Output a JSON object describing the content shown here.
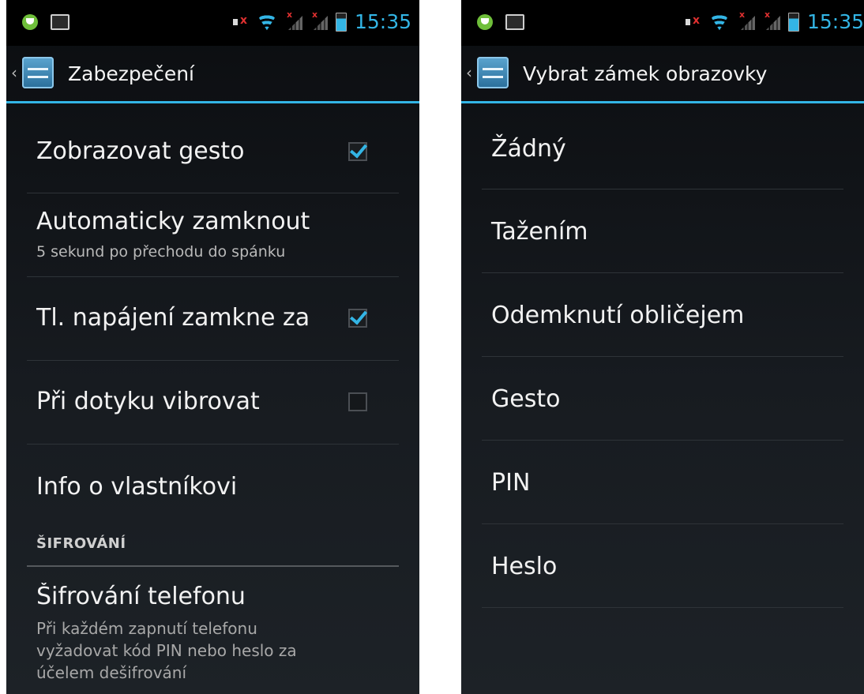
{
  "left": {
    "status": {
      "time": "15:35"
    },
    "title": "Zabezpečení",
    "items": [
      {
        "title": "Zobrazovat gesto",
        "checked": true
      },
      {
        "title": "Automaticky zamknout",
        "subtitle": "5 sekund po přechodu do spánku"
      },
      {
        "title": "Tl. napájení zamkne za",
        "checked": true
      },
      {
        "title": "Při dotyku vibrovat",
        "checked": false
      },
      {
        "title": "Info o vlastníkovi"
      }
    ],
    "section": "ŠIFROVÁNÍ",
    "encryption": {
      "title": "Šifrování telefonu",
      "line1": "Při každém zapnutí telefonu",
      "line2": "vyžadovat kód PIN nebo heslo za",
      "line3": "účelem dešifrování"
    }
  },
  "right": {
    "status": {
      "time": "15:35"
    },
    "title": "Vybrat zámek obrazovky",
    "options": [
      "Žádný",
      "Tažením",
      "Odemknutí obličejem",
      "Gesto",
      "PIN",
      "Heslo"
    ]
  },
  "colors": {
    "accent": "#33b5e5",
    "background": "#15191d",
    "text": "#f2f2f2",
    "subtext": "#b9b9b9"
  },
  "icons": [
    "bug-icon",
    "image-icon",
    "volume-muted-icon",
    "wifi-icon",
    "signal-icon",
    "battery-icon",
    "settings-app-icon",
    "up-caret-icon",
    "checkbox-icon"
  ]
}
